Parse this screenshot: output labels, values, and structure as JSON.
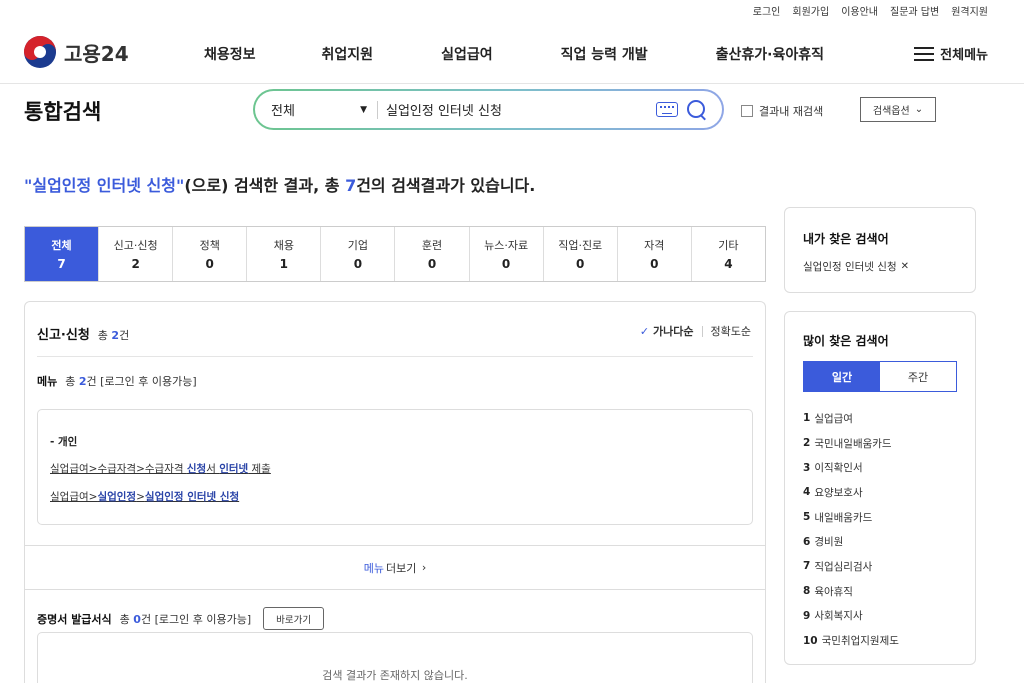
{
  "util_links": [
    "로그인",
    "회원가입",
    "이용안내",
    "질문과 답변",
    "원격지원"
  ],
  "logo_text": "고용24",
  "gnb": [
    "채용정보",
    "취업지원",
    "실업급여",
    "직업 능력 개발",
    "출산휴가·육아휴직"
  ],
  "all_menu_label": "전체메뉴",
  "page_title": "통합검색",
  "search": {
    "scope": "전체",
    "query": "실업인정 인터넷 신청",
    "research_label": "결과내 재검색",
    "option_label": "검색옵션"
  },
  "summary": {
    "quote_open": "\"",
    "keyword": "실업인정 인터넷 신청",
    "quote_close": "\"",
    "mid": "(으로) 검색한 결과, 총 ",
    "count": "7",
    "tail": "건의 검색결과가 있습니다."
  },
  "categories": [
    {
      "label": "전체",
      "count": "7"
    },
    {
      "label": "신고·신청",
      "count": "2"
    },
    {
      "label": "정책",
      "count": "0"
    },
    {
      "label": "채용",
      "count": "1"
    },
    {
      "label": "기업",
      "count": "0"
    },
    {
      "label": "훈련",
      "count": "0"
    },
    {
      "label": "뉴스·자료",
      "count": "0"
    },
    {
      "label": "직업·진로",
      "count": "0"
    },
    {
      "label": "자격",
      "count": "0"
    },
    {
      "label": "기타",
      "count": "4"
    }
  ],
  "section": {
    "title": "신고·신청",
    "count_prefix": "총 ",
    "count": "2",
    "count_suffix": "건",
    "sort_active": "가나다순",
    "sort_other": "정확도순"
  },
  "menu": {
    "title": "메뉴",
    "count_prefix": "총 ",
    "count": "2",
    "count_suffix": "건 [로그인 후 이용가능]",
    "group": "- 개인",
    "link1": {
      "a": "실업급여>수급자격>수급자격 ",
      "b": "신청",
      "c": "서 ",
      "d": "인터넷",
      "e": " 제출"
    },
    "link2": {
      "a": "실업급여>",
      "b": "실업인정",
      "c": ">",
      "d": "실업인정 인터넷 신청"
    },
    "more_a": "메뉴",
    "more_b": " 더보기"
  },
  "cert": {
    "title": "증명서 발급서식",
    "count_prefix": "총 ",
    "count": "0",
    "count_suffix": "건 [로그인 후 이용가능]",
    "go_label": "바로가기",
    "empty": "검색 결과가 존재하지 않습니다."
  },
  "my_search": {
    "title": "내가 찾은 검색어",
    "item": "실업인정 인터넷 신청"
  },
  "popular": {
    "title": "많이 찾은 검색어",
    "tabs": [
      "일간",
      "주간"
    ],
    "items": [
      {
        "rank": "1",
        "text": "실업급여"
      },
      {
        "rank": "2",
        "text": "국민내일배움카드"
      },
      {
        "rank": "3",
        "text": "이직확인서"
      },
      {
        "rank": "4",
        "text": "요양보호사"
      },
      {
        "rank": "5",
        "text": "내일배움카드"
      },
      {
        "rank": "6",
        "text": "경비원"
      },
      {
        "rank": "7",
        "text": "직업심리검사"
      },
      {
        "rank": "8",
        "text": "육아휴직"
      },
      {
        "rank": "9",
        "text": "사회복지사"
      },
      {
        "rank": "10",
        "text": "국민취업지원제도"
      }
    ]
  },
  "colors": {
    "accent": "#3b5bdb",
    "gradient_start": "#6cc58f",
    "gradient_end": "#8fa6e6"
  }
}
